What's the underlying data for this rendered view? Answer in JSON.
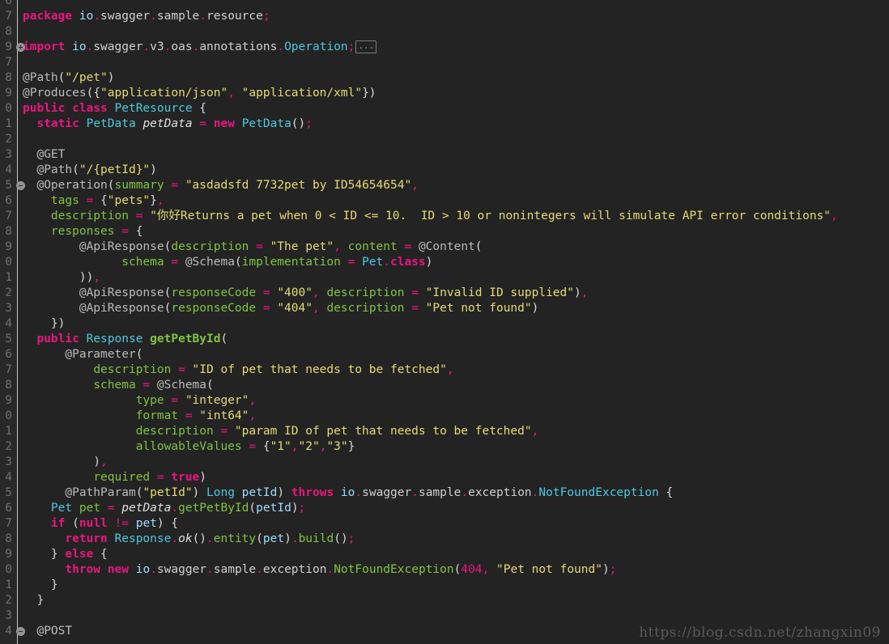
{
  "editor": {
    "background_color": "#232323",
    "gutter_color": "#282828",
    "default_text_color": "#a9b7c6",
    "font_size_px": 14.5,
    "line_height_px": 19,
    "language": "Java"
  },
  "colors": {
    "keyword": "#e8177f",
    "string": "#e6db74",
    "class_name": "#4ec9e0",
    "method": "#80c342",
    "attribute": "#80c342",
    "number": "#e8177f",
    "variable": "#9cdcfe",
    "line_number": "#707070",
    "watermark": "#5a5a5a"
  },
  "gutter": {
    "line_numbers": [
      "6",
      "7",
      "8",
      "9",
      "7",
      "8",
      "9",
      "0",
      "1",
      "2",
      "3",
      "4",
      "5",
      "6",
      "7",
      "8",
      "9",
      "0",
      "1",
      "2",
      "3",
      "4",
      "5",
      "6",
      "7",
      "8",
      "9",
      "0",
      "1",
      "2",
      "3",
      "4",
      "5",
      "6",
      "7",
      "8",
      "9",
      "0",
      "1",
      "2",
      "3",
      "4"
    ],
    "fold_markers": [
      {
        "row": 3,
        "type": "collapsed",
        "symbol": "+"
      },
      {
        "row": 12,
        "type": "expanded",
        "symbol": "-"
      },
      {
        "row": 41,
        "type": "expanded",
        "symbol": "-"
      }
    ]
  },
  "code": {
    "lines": [
      "",
      "package io.swagger.sample.resource;",
      "",
      "import io.swagger.v3.oas.annotations.Operation;",
      "",
      "@Path(\"/pet\")",
      "@Produces({\"application/json\", \"application/xml\"})",
      "public class PetResource {",
      "  static PetData petData = new PetData();",
      "",
      "  @GET",
      "  @Path(\"/{petId}\")",
      "  @Operation(summary = \"asdadsfd 7732pet by ID54654654\",",
      "    tags = {\"pets\"},",
      "    description = \"你好Returns a pet when 0 < ID <= 10.  ID > 10 or nonintegers will simulate API error conditions\",",
      "    responses = {",
      "        @ApiResponse(description = \"The pet\", content = @Content(",
      "              schema = @Schema(implementation = Pet.class)",
      "        )),",
      "        @ApiResponse(responseCode = \"400\", description = \"Invalid ID supplied\"),",
      "        @ApiResponse(responseCode = \"404\", description = \"Pet not found\")",
      "    })",
      "  public Response getPetById(",
      "      @Parameter(",
      "          description = \"ID of pet that needs to be fetched\",",
      "          schema = @Schema(",
      "                type = \"integer\",",
      "                format = \"int64\",",
      "                description = \"param ID of pet that needs to be fetched\",",
      "                allowableValues = {\"1\",\"2\",\"3\"}",
      "          ),",
      "          required = true)",
      "      @PathParam(\"petId\") Long petId) throws io.swagger.sample.exception.NotFoundException {",
      "    Pet pet = petData.getPetById(petId);",
      "    if (null != pet) {",
      "      return Response.ok().entity(pet).build();",
      "    } else {",
      "      throw new io.swagger.sample.exception.NotFoundException(404, \"Pet not found\");",
      "    }",
      "  }",
      "",
      "  @POST"
    ],
    "collapsed_region_marker": "..."
  },
  "watermark": {
    "text": "https://blog.csdn.net/zhangxin09"
  }
}
